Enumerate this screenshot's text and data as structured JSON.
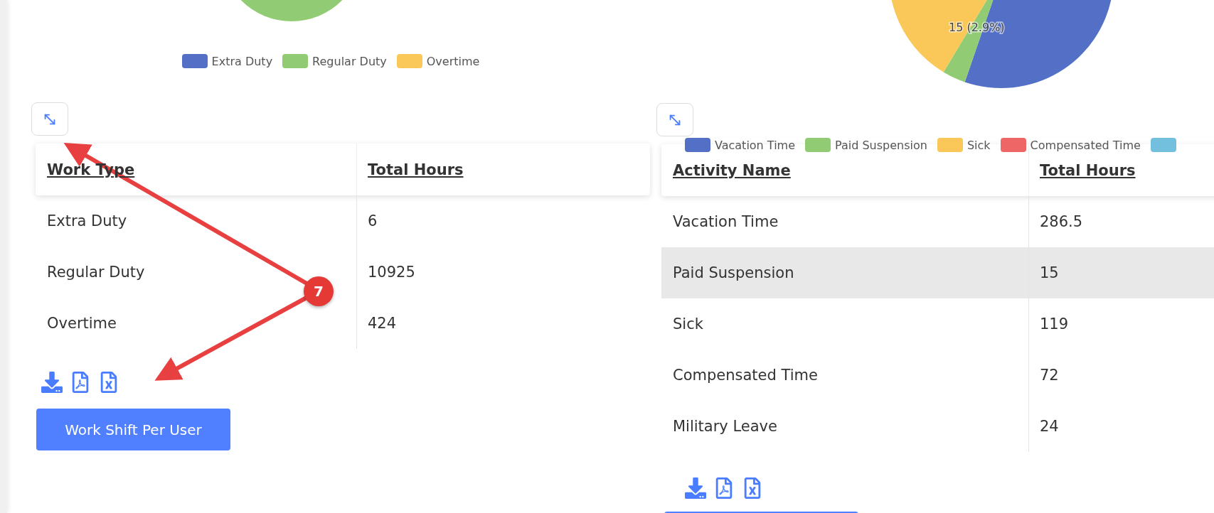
{
  "work_panel": {
    "chart": {
      "legend": [
        {
          "label": "Extra Duty",
          "color": "#5470c6"
        },
        {
          "label": "Regular Duty",
          "color": "#91cc75"
        },
        {
          "label": "Overtime",
          "color": "#fac858"
        }
      ]
    },
    "table": {
      "columns": [
        "Work Type",
        "Total Hours"
      ],
      "rows": [
        {
          "cells": [
            "Extra Duty",
            "6"
          ],
          "selected": false
        },
        {
          "cells": [
            "Regular Duty",
            "10925"
          ],
          "selected": false
        },
        {
          "cells": [
            "Overtime",
            "424"
          ],
          "selected": false
        }
      ]
    },
    "button": "Work Shift Per User"
  },
  "activity_panel": {
    "chart": {
      "slice_label": "15 (2.9%)",
      "legend": [
        {
          "label": "Vacation Time",
          "color": "#5470c6"
        },
        {
          "label": "Paid Suspension",
          "color": "#91cc75"
        },
        {
          "label": "Sick",
          "color": "#fac858"
        },
        {
          "label": "Compensated Time",
          "color": "#ee6666"
        },
        {
          "color": "#73c0de"
        }
      ]
    },
    "table": {
      "columns": [
        "Activity Name",
        "Total Hours"
      ],
      "rows": [
        {
          "cells": [
            "Vacation Time",
            "286.5"
          ],
          "selected": false
        },
        {
          "cells": [
            "Paid Suspension",
            "15"
          ],
          "selected": true
        },
        {
          "cells": [
            "Sick",
            "119"
          ],
          "selected": false
        },
        {
          "cells": [
            "Compensated Time",
            "72"
          ],
          "selected": false
        },
        {
          "cells": [
            "Military Leave",
            "24"
          ],
          "selected": false
        }
      ]
    }
  },
  "annotation": {
    "badge": "7"
  }
}
